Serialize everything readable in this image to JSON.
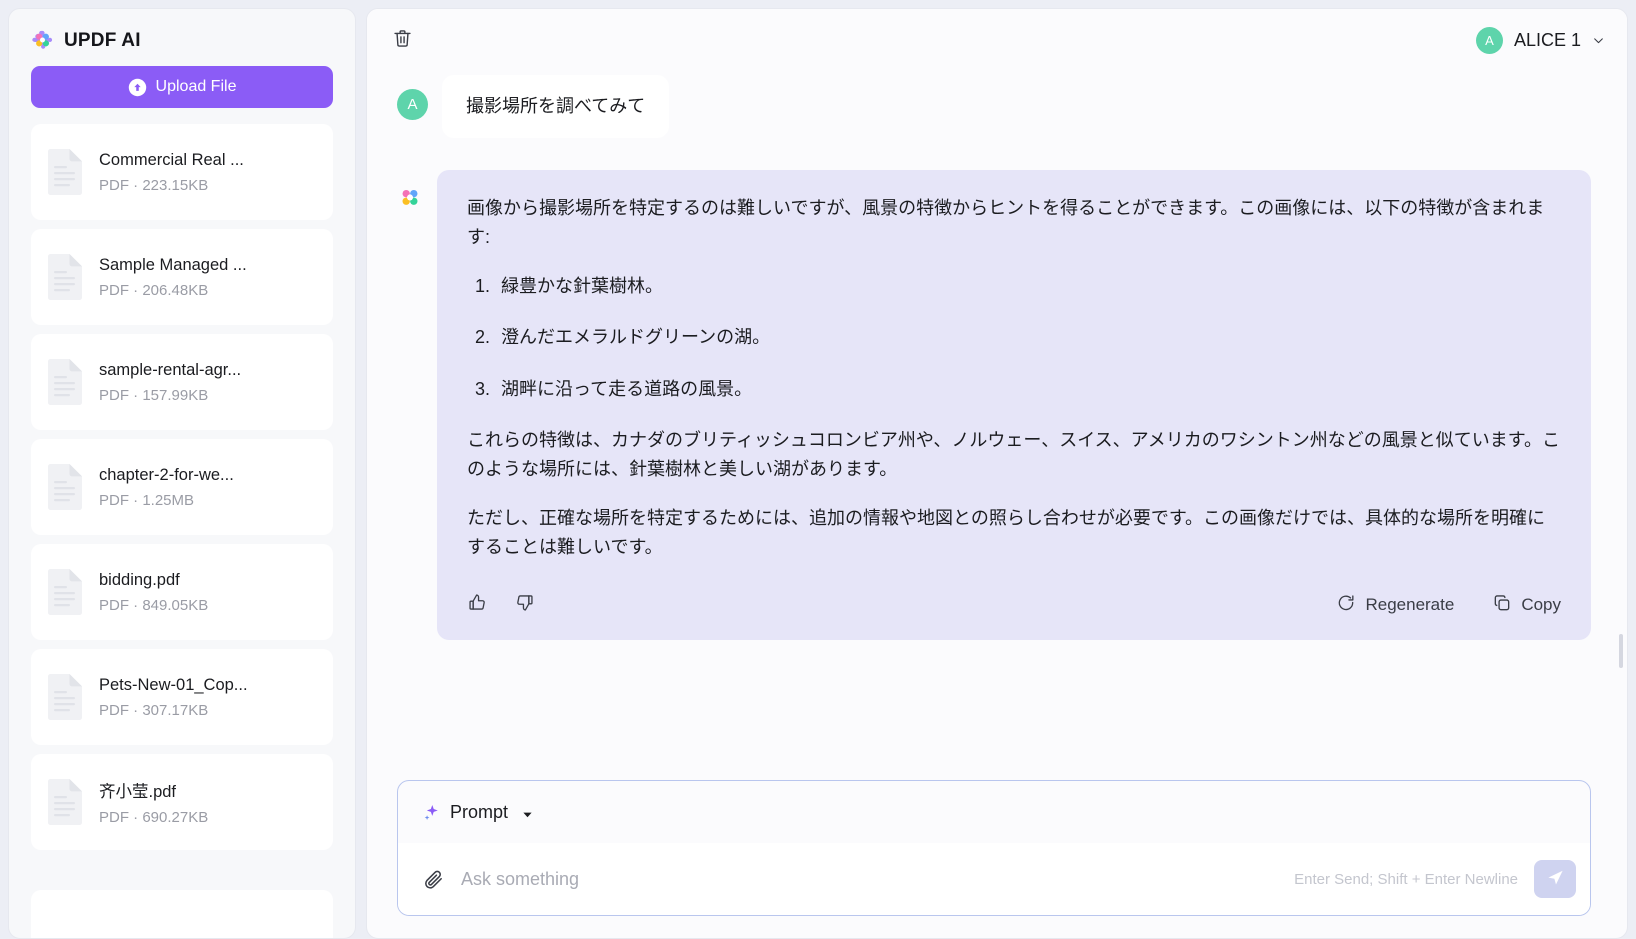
{
  "sidebar": {
    "brand": {
      "name": "UPDF AI",
      "logo_icon": "updf-logo-icon"
    },
    "upload": {
      "label": "Upload File",
      "icon": "upload-arrow-icon"
    },
    "files": [
      {
        "name": "Commercial Real ...",
        "meta": "PDF · 223.15KB",
        "icon": "pdf-file-icon"
      },
      {
        "name": "Sample Managed ...",
        "meta": "PDF · 206.48KB",
        "icon": "pdf-file-icon"
      },
      {
        "name": "sample-rental-agr...",
        "meta": "PDF · 157.99KB",
        "icon": "pdf-file-icon"
      },
      {
        "name": "chapter-2-for-we...",
        "meta": "PDF · 1.25MB",
        "icon": "pdf-file-icon"
      },
      {
        "name": "bidding.pdf",
        "meta": "PDF · 849.05KB",
        "icon": "pdf-file-icon"
      },
      {
        "name": "Pets-New-01_Cop...",
        "meta": "PDF · 307.17KB",
        "icon": "pdf-file-icon"
      },
      {
        "name": "齐小莹.pdf",
        "meta": "PDF · 690.27KB",
        "icon": "pdf-file-icon"
      }
    ]
  },
  "topbar": {
    "delete_icon": "trash-icon",
    "user": {
      "initial": "A",
      "name": "ALICE 1",
      "caret_icon": "chevron-down-icon"
    }
  },
  "chat": {
    "user_message": {
      "initial": "A",
      "text": "撮影場所を調べてみて"
    },
    "ai_message": {
      "logo_icon": "updf-logo-icon",
      "paragraph1": "画像から撮影場所を特定するのは難しいですが、風景の特徴からヒントを得ることができます。この画像には、以下の特徴が含まれます:",
      "list": [
        {
          "num": "1.",
          "text": "緑豊かな針葉樹林。"
        },
        {
          "num": "2.",
          "text": "澄んだエメラルドグリーンの湖。"
        },
        {
          "num": "3.",
          "text": "湖畔に沿って走る道路の風景。"
        }
      ],
      "paragraph2": "これらの特徴は、カナダのブリティッシュコロンビア州や、ノルウェー、スイス、アメリカのワシントン州などの風景と似ています。このような場所には、針葉樹林と美しい湖があります。",
      "paragraph3": "ただし、正確な場所を特定するためには、追加の情報や地図との照らし合わせが必要です。この画像だけでは、具体的な場所を明確にすることは難しいです。",
      "actions": {
        "thumbs_up_icon": "thumbs-up-icon",
        "thumbs_down_icon": "thumbs-down-icon",
        "regenerate_label": "Regenerate",
        "regenerate_icon": "refresh-icon",
        "copy_label": "Copy",
        "copy_icon": "copy-icon"
      }
    }
  },
  "composer": {
    "prompt_label": "Prompt",
    "prompt_icon": "sparkle-icon",
    "prompt_caret_icon": "caret-down-icon",
    "attach_icon": "paperclip-icon",
    "input_placeholder": "Ask something",
    "input_value": "",
    "hint": "Enter Send; Shift + Enter Newline",
    "send_icon": "send-icon"
  },
  "colors": {
    "accent": "#8b5cf6",
    "ai_bubble": "#e6e5f8",
    "avatar": "#5ed4ab",
    "page_bg": "#eceef5",
    "composer_border": "#b9c6ee"
  }
}
